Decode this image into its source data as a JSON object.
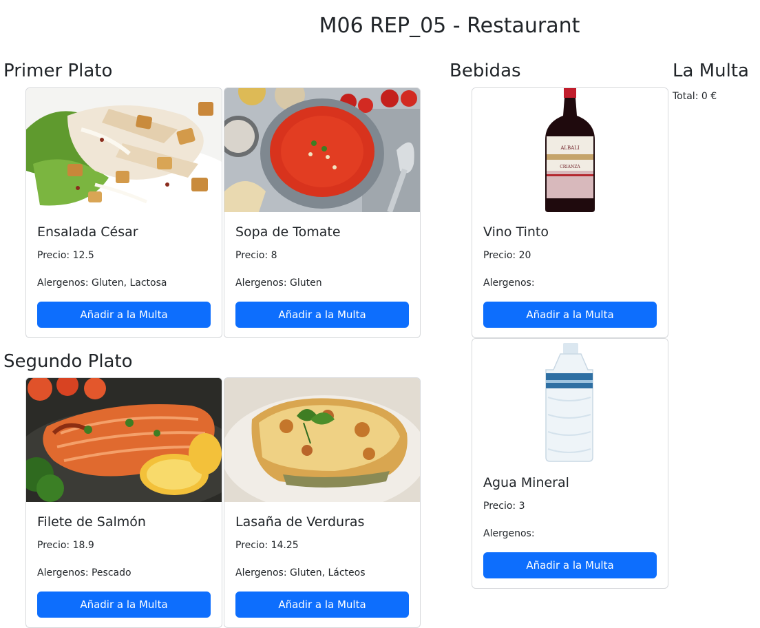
{
  "page": {
    "title": "M06 REP_05 - Restaurant"
  },
  "sections": {
    "primer_plato": "Primer Plato",
    "segundo_plato": "Segundo Plato",
    "bebidas": "Bebidas",
    "la_multa": "La Multa"
  },
  "cart": {
    "total_text": "Total: 0 €"
  },
  "add_button_label": "Añadir a la Multa",
  "primer_plato": [
    {
      "name": "Ensalada César",
      "price": "Precio: 12.5",
      "allergens": "Alergenos: Gluten, Lactosa",
      "image": "caesar-salad-image"
    },
    {
      "name": "Sopa de Tomate",
      "price": "Precio: 8",
      "allergens": "Alergenos: Gluten",
      "image": "tomato-soup-image"
    }
  ],
  "segundo_plato": [
    {
      "name": "Filete de Salmón",
      "price": "Precio: 18.9",
      "allergens": "Alergenos: Pescado",
      "image": "salmon-fillet-image"
    },
    {
      "name": "Lasaña de Verduras",
      "price": "Precio: 14.25",
      "allergens": "Alergenos: Gluten, Lácteos",
      "image": "vegetable-lasagna-image"
    }
  ],
  "bebidas": [
    {
      "name": "Vino Tinto",
      "price": "Precio: 20",
      "allergens": "Alergenos:",
      "image": "red-wine-bottle-image",
      "label_brand": "ALBALI",
      "label_type": "CRIANZA"
    },
    {
      "name": "Agua Mineral",
      "price": "Precio: 3",
      "allergens": "Alergenos:",
      "image": "water-bottle-image"
    }
  ],
  "colors": {
    "button": "#0d6efd",
    "card_border": "#d6d8db",
    "text": "#212529"
  }
}
